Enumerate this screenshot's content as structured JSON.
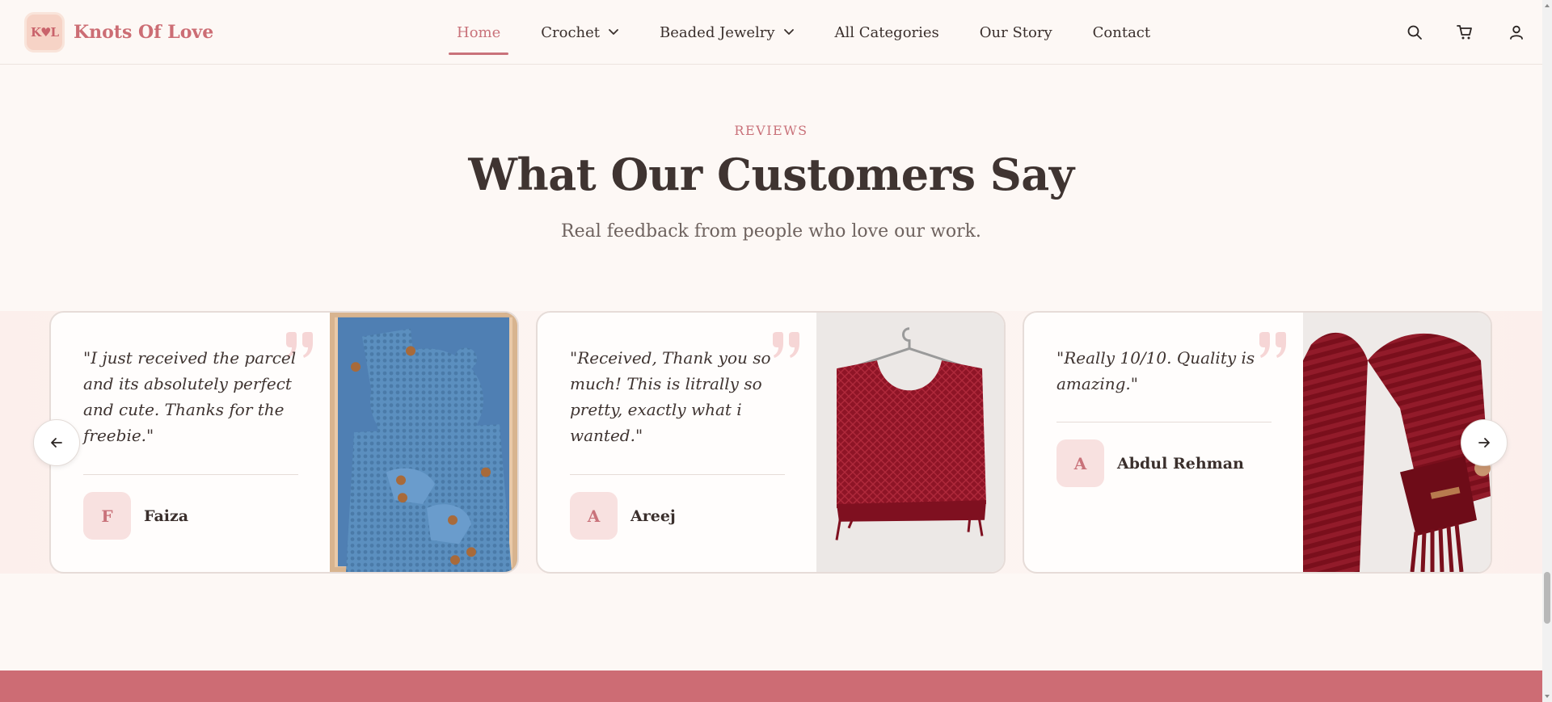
{
  "brand": {
    "logo_text": "K♥L",
    "name": "Knots Of Love"
  },
  "nav": {
    "items": [
      {
        "label": "Home",
        "active": true,
        "dropdown": false
      },
      {
        "label": "Crochet",
        "active": false,
        "dropdown": true
      },
      {
        "label": "Beaded Jewelry",
        "active": false,
        "dropdown": true
      },
      {
        "label": "All Categories",
        "active": false,
        "dropdown": false
      },
      {
        "label": "Our Story",
        "active": false,
        "dropdown": false
      },
      {
        "label": "Contact",
        "active": false,
        "dropdown": false
      }
    ]
  },
  "header_icons": [
    "search-icon",
    "cart-icon",
    "user-icon"
  ],
  "section": {
    "eyebrow": "REVIEWS",
    "title": "What Our Customers Say",
    "subtitle": "Real feedback from people who love our work."
  },
  "reviews": [
    {
      "quote": "\"I just received the parcel and its absolutely perfect and cute. Thanks for the freebie.\"",
      "initial": "F",
      "name": "Faiza",
      "photo": "blue crochet baby romper set"
    },
    {
      "quote": "\"Received, Thank you so much! This is litrally so pretty, exactly what i wanted.\"",
      "initial": "A",
      "name": "Areej",
      "photo": "red crochet crop top on hanger"
    },
    {
      "quote": "\"Really 10/10. Quality is amazing.\"",
      "initial": "A",
      "name": "Abdul Rehman",
      "photo": "maroon crochet scarf"
    }
  ],
  "colors": {
    "accent": "#c9727a",
    "background": "#fdf8f5",
    "footer_band": "#cd6c74"
  }
}
